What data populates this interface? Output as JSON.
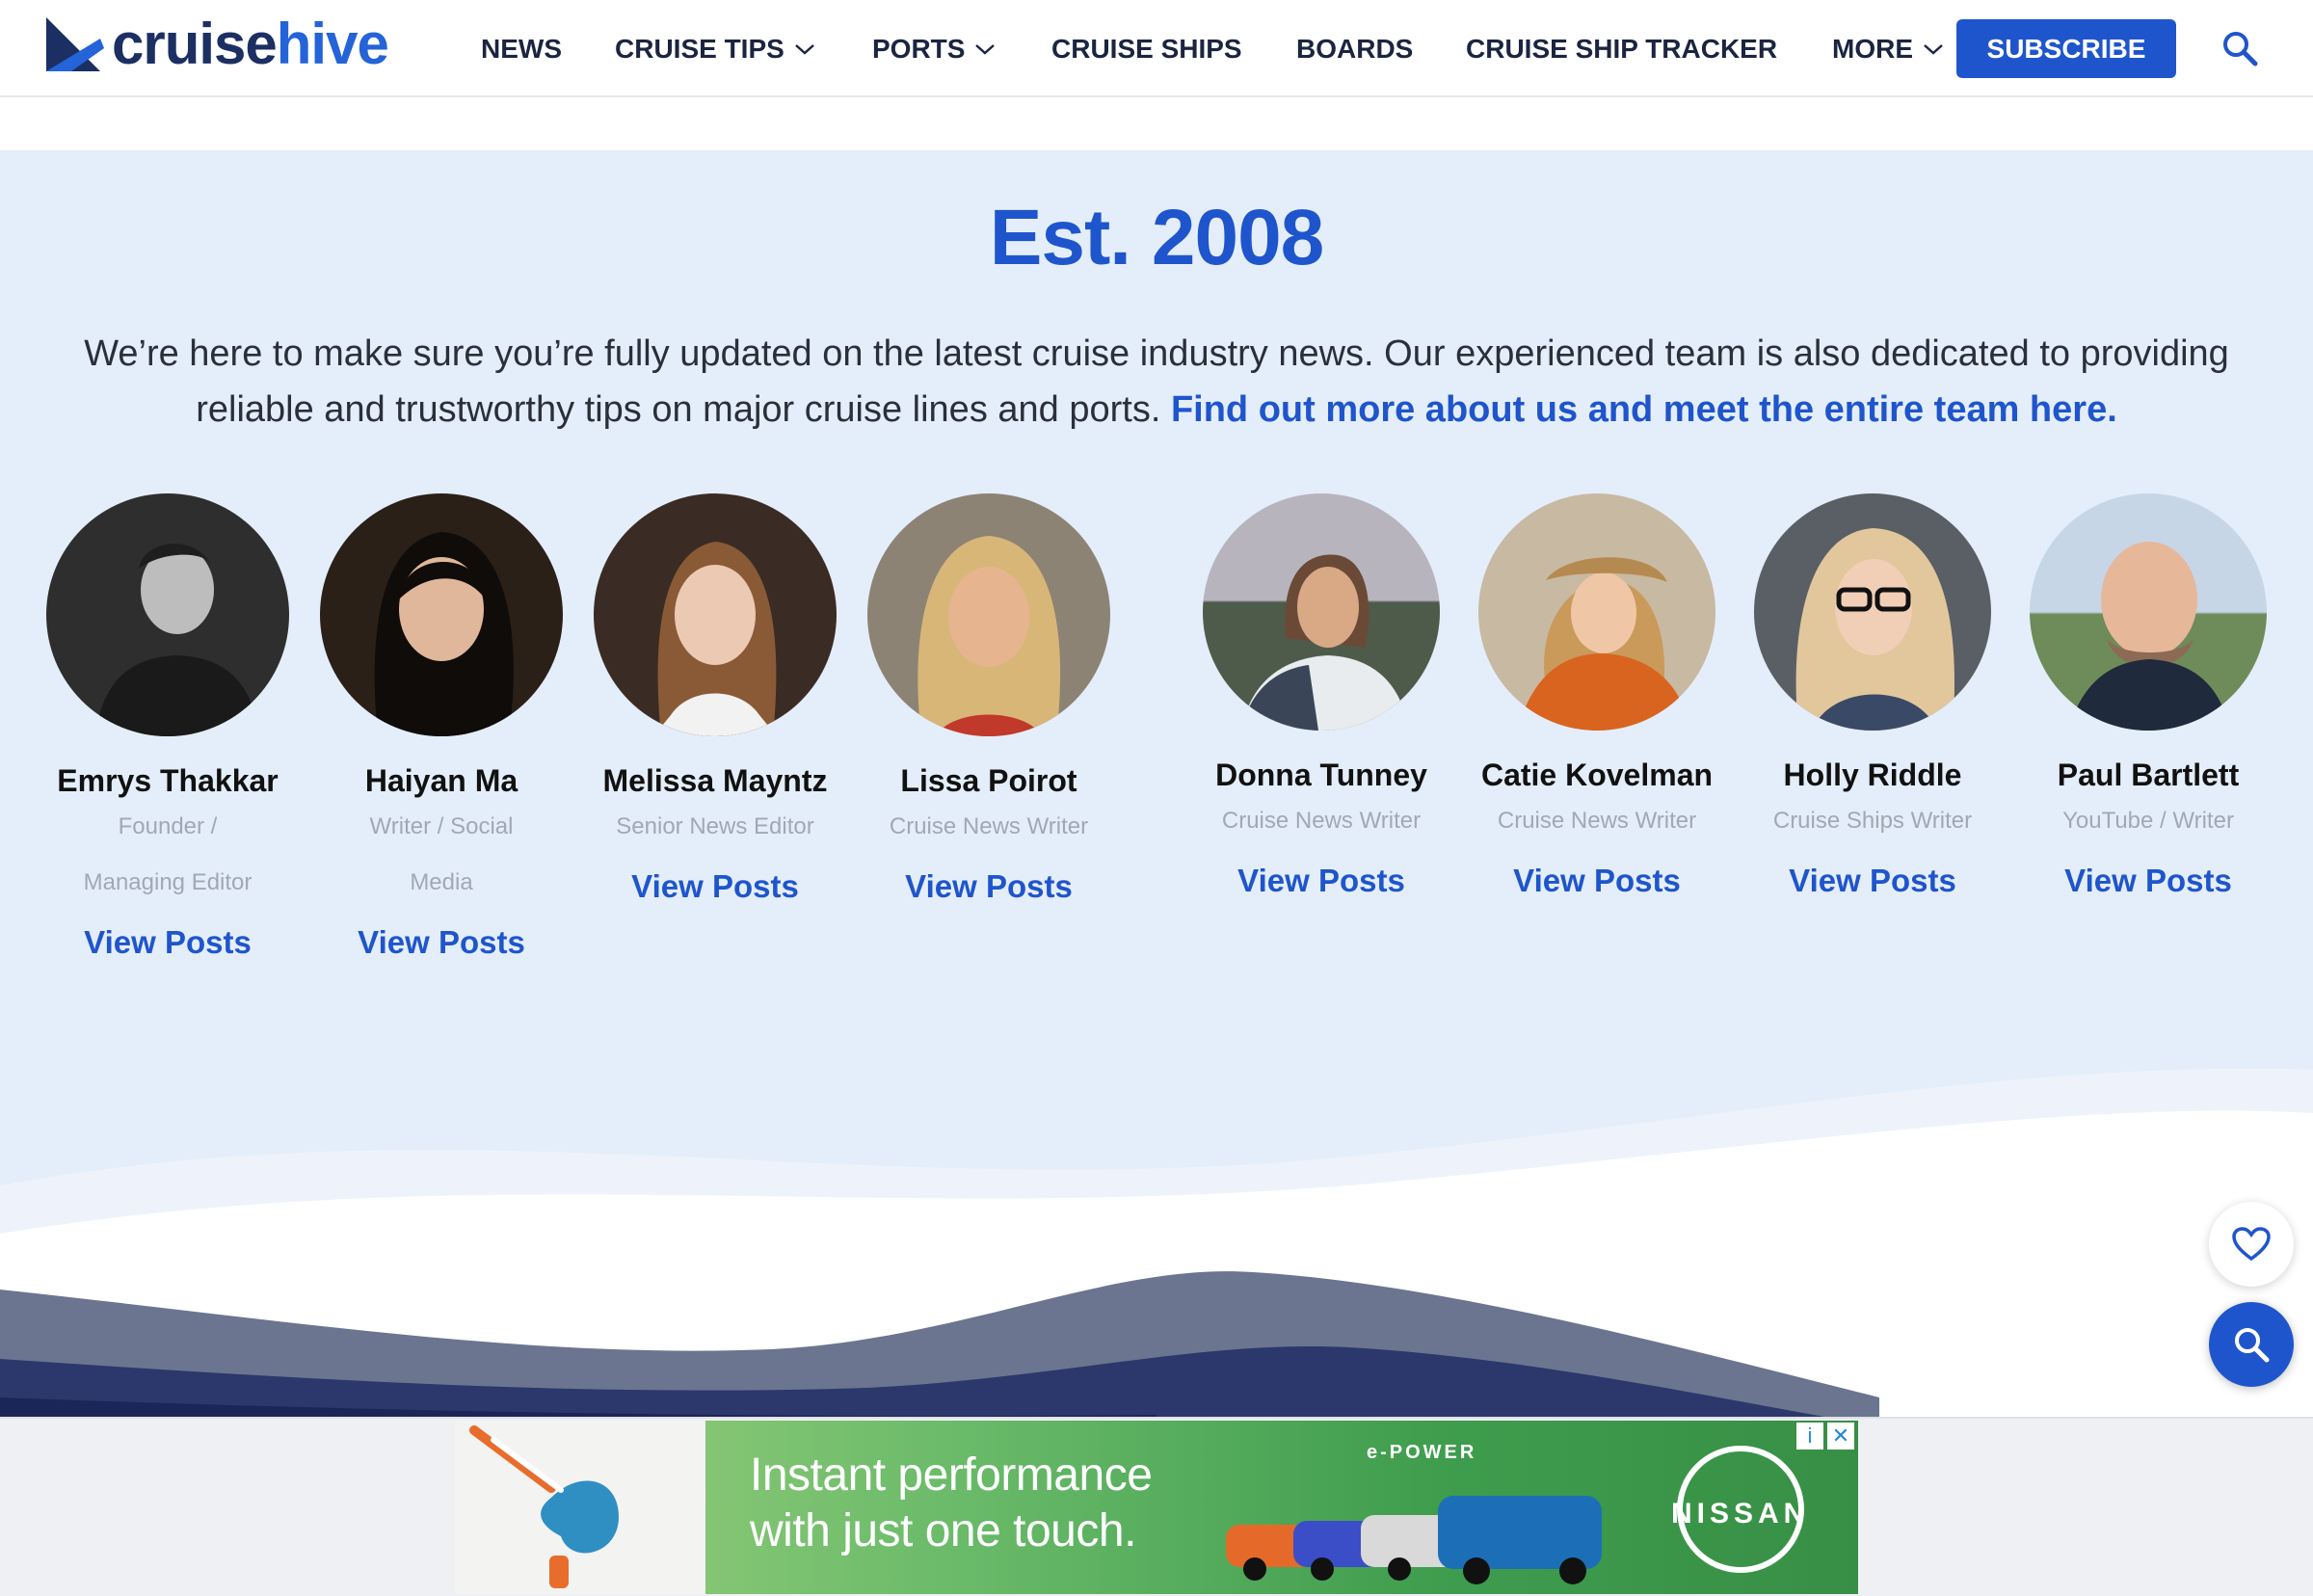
{
  "header": {
    "logo": {
      "part1": "cruise",
      "part2": "hive"
    },
    "nav": [
      {
        "label": "NEWS",
        "dropdown": false
      },
      {
        "label": "CRUISE TIPS",
        "dropdown": true
      },
      {
        "label": "PORTS",
        "dropdown": true
      },
      {
        "label": "CRUISE SHIPS",
        "dropdown": false
      },
      {
        "label": "BOARDS",
        "dropdown": false
      },
      {
        "label": "CRUISE SHIP TRACKER",
        "dropdown": false
      },
      {
        "label": "MORE",
        "dropdown": true
      }
    ],
    "subscribe_label": "SUBSCRIBE",
    "search_icon": "search-icon"
  },
  "team": {
    "title": "Est. 2008",
    "intro_text": "We’re here to make sure you’re fully updated on the latest cruise industry news. Our experienced team is also dedicated to providing reliable and trustworthy tips on major cruise lines and ports.",
    "intro_link": "Find out more about us and meet the entire team here.",
    "members": [
      {
        "name": "Emrys Thakkar",
        "role": "Founder / Managing Editor",
        "link": "View Posts"
      },
      {
        "name": "Haiyan Ma",
        "role": "Writer / Social Media",
        "link": "View Posts"
      },
      {
        "name": "Melissa Mayntz",
        "role": "Senior News Editor",
        "link": "View Posts"
      },
      {
        "name": "Lissa Poirot",
        "role": "Cruise News Writer",
        "link": "View Posts"
      },
      {
        "name": "Donna Tunney",
        "role": "Cruise News Writer",
        "link": "View Posts"
      },
      {
        "name": "Catie Kovelman",
        "role": "Cruise News Writer",
        "link": "View Posts"
      },
      {
        "name": "Holly Riddle",
        "role": "Cruise Ships Writer",
        "link": "View Posts"
      },
      {
        "name": "Paul Bartlett",
        "role": "YouTube / Writer",
        "link": "View Posts"
      }
    ]
  },
  "floating": {
    "favorite_icon": "heart-icon",
    "search_icon": "search-icon"
  },
  "ad": {
    "headline_line1": "Instant performance",
    "headline_line2": "with just one touch.",
    "badge": "e-POWER",
    "brand": "NISSAN",
    "info_icon": "i",
    "close_icon": "✕"
  },
  "colors": {
    "accent": "#1f55cc",
    "navy": "#1c2f63",
    "band": "#e4eefa"
  }
}
